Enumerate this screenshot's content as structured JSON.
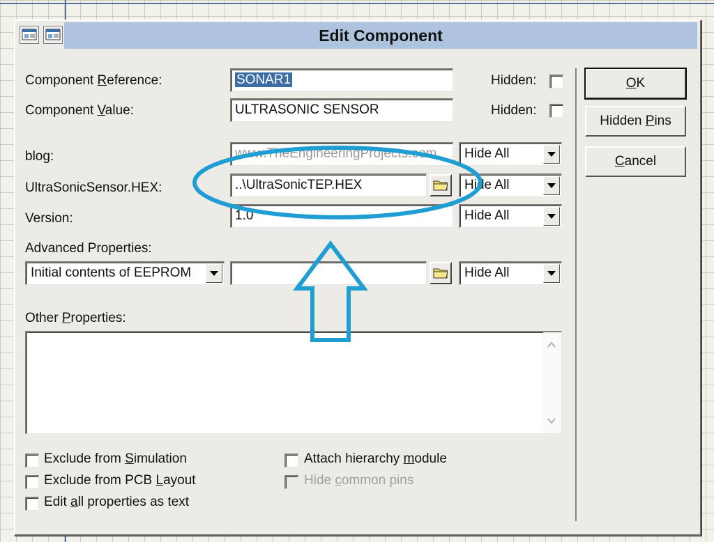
{
  "window": {
    "title": "Edit Component"
  },
  "fields": {
    "component_reference": {
      "label_pre": "Component ",
      "label_u": "R",
      "label_post": "eference:",
      "value": "SONAR1"
    },
    "component_value": {
      "label_pre": "Component ",
      "label_u": "V",
      "label_post": "alue:",
      "value": "ULTRASONIC SENSOR"
    },
    "hidden_label": "Hidden:",
    "blog": {
      "label": "blog:",
      "value": "www.TheEngineeringProjects.com",
      "visibility": "Hide All"
    },
    "hex": {
      "label": "UltraSonicSensor.HEX:",
      "value": "..\\UltraSonicTEP.HEX",
      "visibility": "Hide All"
    },
    "version": {
      "label": "Version:",
      "value": "1.0",
      "visibility": "Hide All"
    }
  },
  "advanced": {
    "label": "Advanced Properties:",
    "property": "Initial contents of EEPROM",
    "value": "",
    "visibility": "Hide All"
  },
  "other": {
    "label_pre": "Other ",
    "label_u": "P",
    "label_post": "roperties:",
    "text": ""
  },
  "checkboxes": {
    "exclude_sim": {
      "pre": "Exclude from ",
      "u": "S",
      "post": "imulation",
      "checked": false
    },
    "exclude_pcb": {
      "pre": "Exclude from PCB ",
      "u": "L",
      "post": "ayout",
      "checked": false
    },
    "edit_text": {
      "pre": "Edit ",
      "u": "a",
      "post": "ll properties as text",
      "checked": false
    },
    "attach_module": {
      "pre": "Attach hierarchy ",
      "u": "m",
      "post": "odule",
      "checked": false
    },
    "hide_pins": {
      "pre": "Hide ",
      "u": "c",
      "post": "ommon pins",
      "checked": false
    }
  },
  "buttons": {
    "ok": {
      "u": "O",
      "post": "K"
    },
    "hidden_pins": {
      "pre": "Hidden ",
      "u": "P",
      "post": "ins"
    },
    "cancel": {
      "u": "C",
      "post": "ancel"
    }
  },
  "colors": {
    "titlebar": "#aec3de",
    "annotation": "#1f9ed4"
  }
}
